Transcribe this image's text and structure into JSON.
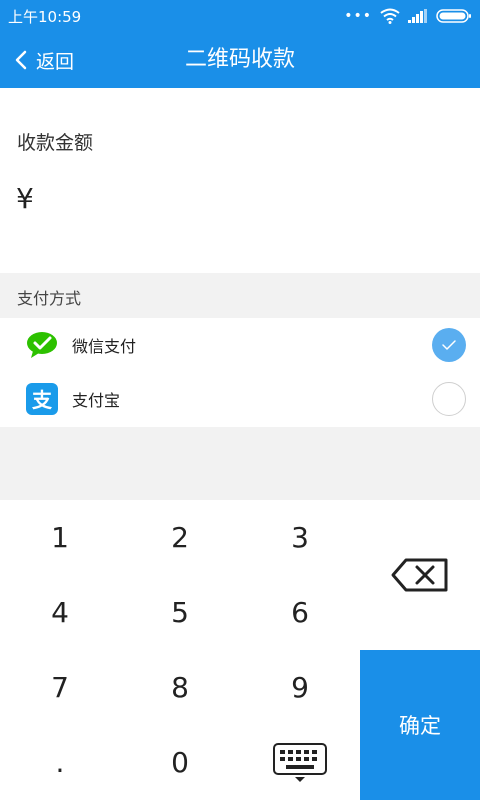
{
  "status_bar": {
    "time": "上午10:59",
    "signal_dots": "•••"
  },
  "app_bar": {
    "back_label": "返回",
    "title": "二维码收款"
  },
  "amount": {
    "label": "收款金额",
    "currency": "¥",
    "value": ""
  },
  "payment": {
    "section_title": "支付方式",
    "methods": [
      {
        "name": "微信支付",
        "icon": "wechat-pay-icon",
        "selected": true
      },
      {
        "name": "支付宝",
        "icon": "alipay-icon",
        "selected": false
      }
    ]
  },
  "keypad": {
    "keys": [
      "1",
      "2",
      "3",
      "4",
      "5",
      "6",
      "7",
      "8",
      "9",
      ".",
      "0"
    ],
    "confirm_label": "确定"
  },
  "colors": {
    "primary": "#1a8fe8",
    "checked": "#5aaef0",
    "wechat": "#2dc100",
    "alipay": "#1a9bea"
  }
}
